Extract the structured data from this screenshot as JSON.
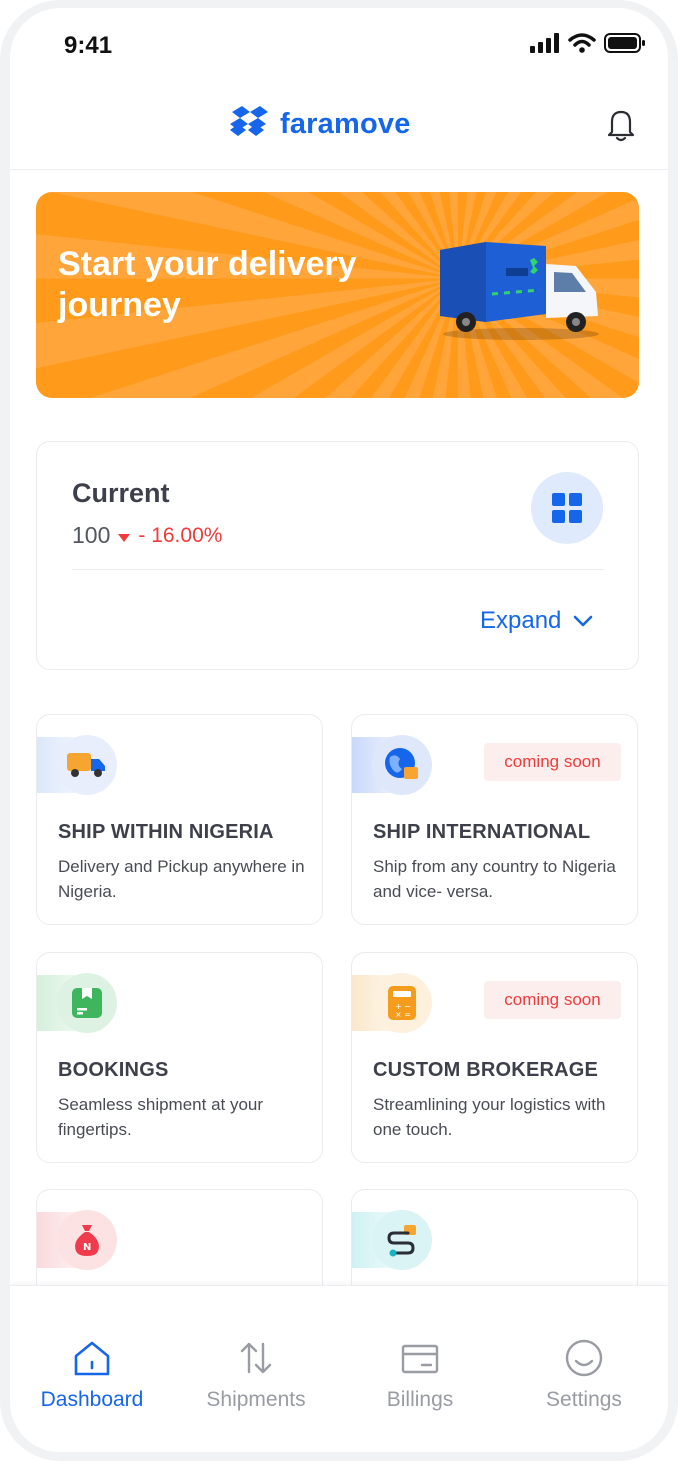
{
  "status_bar": {
    "time": "9:41"
  },
  "header": {
    "logo_text": "faramove"
  },
  "banner": {
    "title": "Start your delivery journey"
  },
  "current": {
    "title": "Current",
    "value": "100",
    "change": "- 16.00%",
    "expand_label": "Expand"
  },
  "services": [
    {
      "title": "SHIP WITHIN NIGERIA",
      "description": "Delivery and Pickup anywhere in Nigeria.",
      "badge": ""
    },
    {
      "title": "SHIP INTERNATIONAL",
      "description": "Ship from any country to Nigeria and vice- versa.",
      "badge": "coming soon"
    },
    {
      "title": "BOOKINGS",
      "description": "Seamless shipment at your fingertips.",
      "badge": ""
    },
    {
      "title": "CUSTOM BROKERAGE",
      "description": "Streamlining your logistics with one touch.",
      "badge": "coming soon"
    }
  ],
  "nav": [
    {
      "label": "Dashboard",
      "icon": "home-icon",
      "active": true
    },
    {
      "label": "Shipments",
      "icon": "arrows-updown-icon",
      "active": false
    },
    {
      "label": "Billings",
      "icon": "card-icon",
      "active": false
    },
    {
      "label": "Settings",
      "icon": "smile-icon",
      "active": false
    }
  ],
  "colors": {
    "brand": "#1566ea",
    "banner": "#ff9a1a",
    "negative": "#ef3b3b"
  }
}
